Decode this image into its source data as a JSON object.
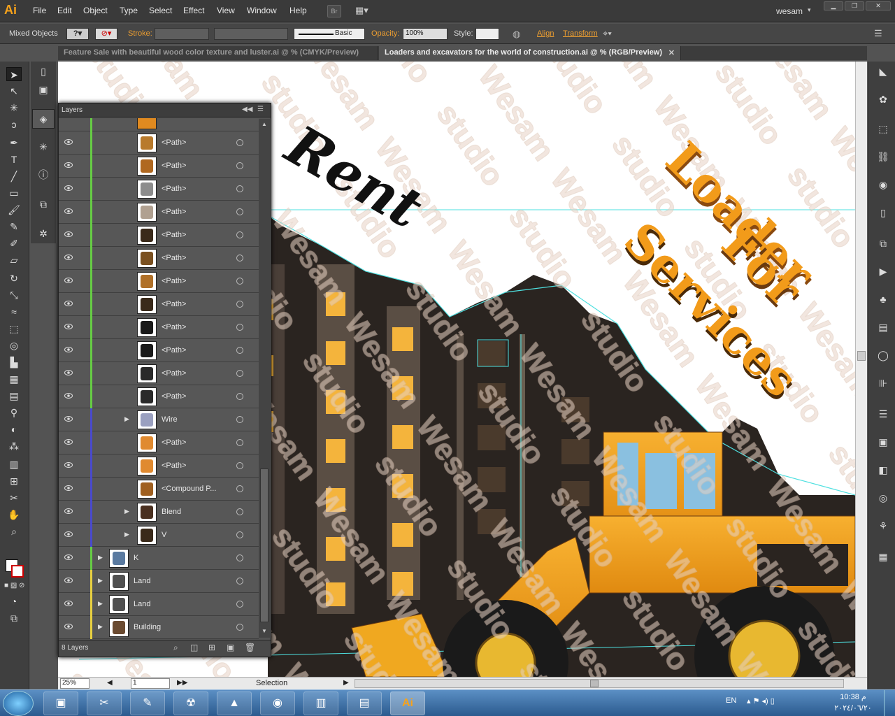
{
  "app": {
    "logo": "Ai",
    "user": "wesam"
  },
  "menu": [
    "File",
    "Edit",
    "Object",
    "Type",
    "Select",
    "Effect",
    "View",
    "Window",
    "Help"
  ],
  "menu_extra": {
    "bridge": "Br"
  },
  "control": {
    "selection_type": "Mixed Objects",
    "stroke_label": "Stroke:",
    "brush_label": "Basic",
    "opacity_label": "Opacity:",
    "opacity_value": "100%",
    "style_label": "Style:",
    "align_label": "Align",
    "transform_label": "Transform"
  },
  "tabs": [
    {
      "label": "Feature Sale with beautiful wood color texture and luster.ai @ % (CMYK/Preview)",
      "active": false
    },
    {
      "label": "Loaders and excavators for the world of construction.ai @ % (RGB/Preview)",
      "active": true
    }
  ],
  "layers_panel": {
    "title": "Layers",
    "rows": [
      {
        "name": "<Path>",
        "color": "#66cc44",
        "thumb": "#b87a2c"
      },
      {
        "name": "<Path>",
        "color": "#66cc44",
        "thumb": "#b06820"
      },
      {
        "name": "<Path>",
        "color": "#66cc44",
        "thumb": "#8c8c8c"
      },
      {
        "name": "<Path>",
        "color": "#66cc44",
        "thumb": "#b0a090"
      },
      {
        "name": "<Path>",
        "color": "#66cc44",
        "thumb": "#3a2a1a"
      },
      {
        "name": "<Path>",
        "color": "#66cc44",
        "thumb": "#7a5020"
      },
      {
        "name": "<Path>",
        "color": "#66cc44",
        "thumb": "#b07028"
      },
      {
        "name": "<Path>",
        "color": "#66cc44",
        "thumb": "#3a2a1a"
      },
      {
        "name": "<Path>",
        "color": "#66cc44",
        "thumb": "#1a1a1a"
      },
      {
        "name": "<Path>",
        "color": "#66cc44",
        "thumb": "#1a1a1a"
      },
      {
        "name": "<Path>",
        "color": "#66cc44",
        "thumb": "#2a2a2a"
      },
      {
        "name": "<Path>",
        "color": "#66cc44",
        "thumb": "#2a2a2a"
      },
      {
        "name": "Wire",
        "color": "#4a4acc",
        "thumb": "#9aa0c0",
        "expand": true
      },
      {
        "name": "<Path>",
        "color": "#4a4acc",
        "thumb": "#e08a30"
      },
      {
        "name": "<Path>",
        "color": "#4a4acc",
        "thumb": "#e08a30"
      },
      {
        "name": "<Compound P...",
        "color": "#4a4acc",
        "thumb": "#a06020"
      },
      {
        "name": "Blend",
        "color": "#4a4acc",
        "thumb": "#4a3020",
        "expand": true
      },
      {
        "name": "V",
        "color": "#4a4acc",
        "thumb": "#3a2a1a",
        "expand": true
      },
      {
        "name": "K",
        "color": "#66cc44",
        "thumb": "#5a7aa0",
        "expand": true,
        "top": true
      },
      {
        "name": "Land",
        "color": "#e8d040",
        "thumb": "#505050",
        "expand": true,
        "top": true
      },
      {
        "name": "Land",
        "color": "#e8d040",
        "thumb": "#505050",
        "expand": true,
        "top": true
      },
      {
        "name": "Building",
        "color": "#e8d040",
        "thumb": "#6a4a30",
        "expand": true,
        "top": true
      }
    ],
    "footer": "8 Layers"
  },
  "artwork": {
    "rent": "Rent",
    "headline1": "Loader",
    "headline2": "For",
    "headline3": "Services",
    "watermark": "Wesam studio"
  },
  "status": {
    "zoom": "25%",
    "page": "1",
    "tool": "Selection"
  },
  "taskbar": {
    "lang": "EN",
    "time": "10:38 م",
    "date": "٢٠٢٤/٠٦/٢٠"
  }
}
